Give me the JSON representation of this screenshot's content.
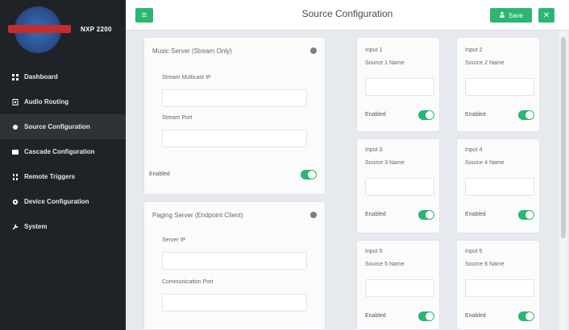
{
  "brand": {
    "model": "NXP 2200",
    "logo_name": "brand-logo"
  },
  "sidebar": {
    "items": [
      {
        "label": "Dashboard",
        "icon": "grid-icon",
        "active": false
      },
      {
        "label": "Audio Routing",
        "icon": "routing-icon",
        "active": false
      },
      {
        "label": "Source Configuration",
        "icon": "dot-icon",
        "active": true
      },
      {
        "label": "Cascade Configuration",
        "icon": "cascade-icon",
        "active": false
      },
      {
        "label": "Remote Triggers",
        "icon": "trigger-icon",
        "active": false
      },
      {
        "label": "Device Configuration",
        "icon": "device-icon",
        "active": false
      },
      {
        "label": "System",
        "icon": "wrench-icon",
        "active": false
      }
    ]
  },
  "topbar": {
    "title": "Source Configuration",
    "save_label": "Save",
    "menu_icon": "menu-icon",
    "close_icon": "close-icon"
  },
  "music_server": {
    "title": "Music Server (Stream Only)",
    "ip_label": "Stream Multicast IP",
    "ip_value": "",
    "port_label": "Stream Port",
    "port_value": "",
    "enabled_label": "Enabled",
    "enabled": true
  },
  "paging_server": {
    "title": "Paging Server (Endpoint Client)",
    "server_ip_label": "Server IP",
    "server_ip_value": "",
    "comm_port_label": "Communication Port",
    "comm_port_value": ""
  },
  "inputs": [
    {
      "title": "Input 1",
      "name_label": "Source 1 Name",
      "name_value": "",
      "enabled_label": "Enabled",
      "enabled": true
    },
    {
      "title": "Input 2",
      "name_label": "Source 2 Name",
      "name_value": "",
      "enabled_label": "Enabled",
      "enabled": true
    },
    {
      "title": "Input 3",
      "name_label": "Source 3 Name",
      "name_value": "",
      "enabled_label": "Enabled",
      "enabled": true
    },
    {
      "title": "Input 4",
      "name_label": "Source 4 Name",
      "name_value": "",
      "enabled_label": "Enabled",
      "enabled": true
    },
    {
      "title": "Input 5",
      "name_label": "Source 5 Name",
      "name_value": "",
      "enabled_label": "Enabled",
      "enabled": true
    },
    {
      "title": "Input 6",
      "name_label": "Source 6 Name",
      "name_value": "",
      "enabled_label": "Enabled",
      "enabled": true
    }
  ],
  "colors": {
    "accent": "#2bb673",
    "sidebar_bg": "#1f2226",
    "active_bg": "#2f3338"
  }
}
